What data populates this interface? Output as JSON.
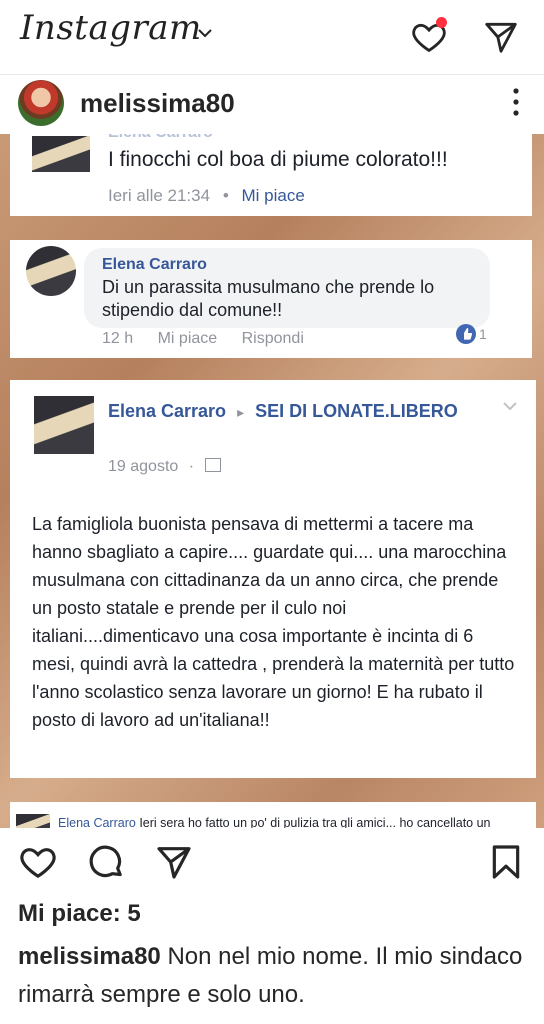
{
  "header": {
    "logo": "Instagram"
  },
  "post": {
    "username": "melissima80",
    "likes": "Mi piace: 5",
    "caption_user": "melissima80",
    "caption_text": "Non nel mio nome. Il mio sindaco rimarrà sempre e solo uno."
  },
  "screenshot": {
    "card1": {
      "partial_name": "Elena Carraro",
      "comment": "I finocchi col boa di piume colorato!!!",
      "time": "Ieri alle 21:34",
      "like": "Mi piace"
    },
    "card2": {
      "name": "Elena Carraro",
      "comment": "Di un parassita musulmano che prende lo stipendio dal comune!!",
      "time": "12 h",
      "like": "Mi piace",
      "reply": "Rispondi",
      "reaction_count": "1"
    },
    "card3": {
      "name": "Elena Carraro",
      "arrow": "▸",
      "group": "SEI DI LONATE.LIBERO",
      "date": "19 agosto",
      "sep": "·",
      "body": "La famigliola buonista pensava di mettermi a tacere ma hanno sbagliato a capire.... guardate qui.... una marocchina musulmana con cittadinanza da un anno circa, che prende un posto statale e prende per il culo noi italiani....dimenticavo una cosa importante è incinta di 6 mesi, quindi avrà la cattedra , prenderà la maternità per tutto l'anno scolastico senza lavorare un giorno! E ha rubato il posto di lavoro ad un'italiana!!"
    },
    "card4": {
      "name": "Elena Carraro",
      "text": "Ieri sera ho fatto un po' di pulizia tra gli amici... ho cancellato un"
    }
  },
  "icons": [
    "chevron-down-icon",
    "heart-icon",
    "send-icon",
    "more-icon",
    "comment-icon",
    "bookmark-icon",
    "like-icon"
  ]
}
